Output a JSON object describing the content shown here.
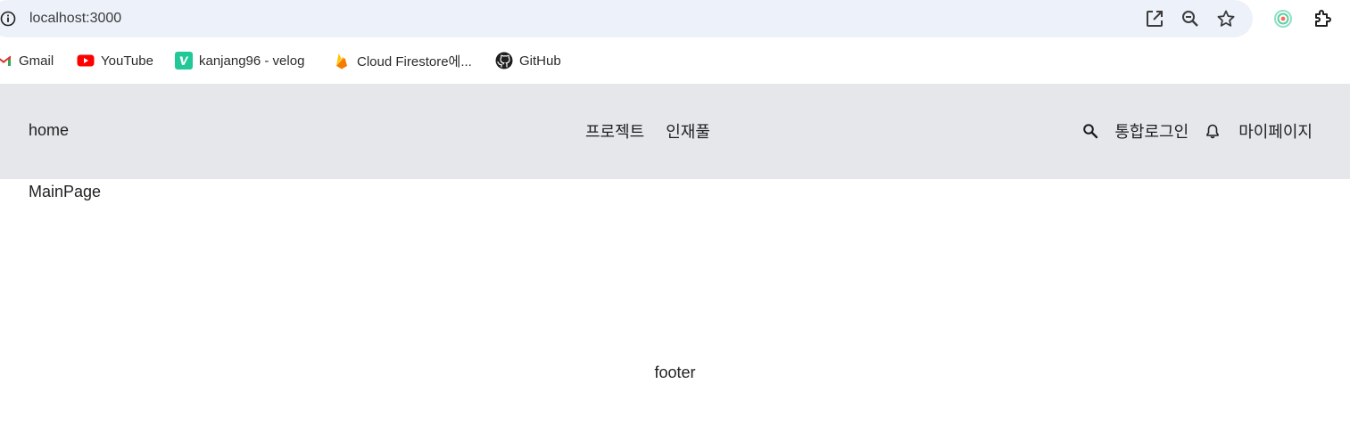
{
  "browser": {
    "url": "localhost:3000",
    "icons": {
      "site_info": "info-icon",
      "open_in_app": "open-external-icon",
      "zoom": "zoom-out-icon",
      "bookmark": "star-icon",
      "extension_1": "extension-circle-icon",
      "extensions": "puzzle-icon"
    }
  },
  "bookmarks": [
    {
      "label": "Gmail",
      "icon": "gmail-icon"
    },
    {
      "label": "YouTube",
      "icon": "youtube-icon"
    },
    {
      "label": "kanjang96 - velog",
      "icon": "velog-icon"
    },
    {
      "label": "Cloud Firestore에...",
      "icon": "firebase-icon"
    },
    {
      "label": "GitHub",
      "icon": "github-icon"
    }
  ],
  "header": {
    "home": "home",
    "center_nav": [
      "프로젝트",
      "인재풀"
    ],
    "login": "통합로그인",
    "mypage": "마이페이지",
    "search_icon": "search-icon",
    "bell_icon": "bell-icon",
    "background": "#e5e7eb"
  },
  "main": {
    "title": "MainPage"
  },
  "footer": {
    "text": "footer"
  },
  "colors": {
    "omnibox": "#edf1f9",
    "youtube_red": "#ff0000",
    "velog_green": "#20c997",
    "firebase_orange": "#ffa000"
  }
}
